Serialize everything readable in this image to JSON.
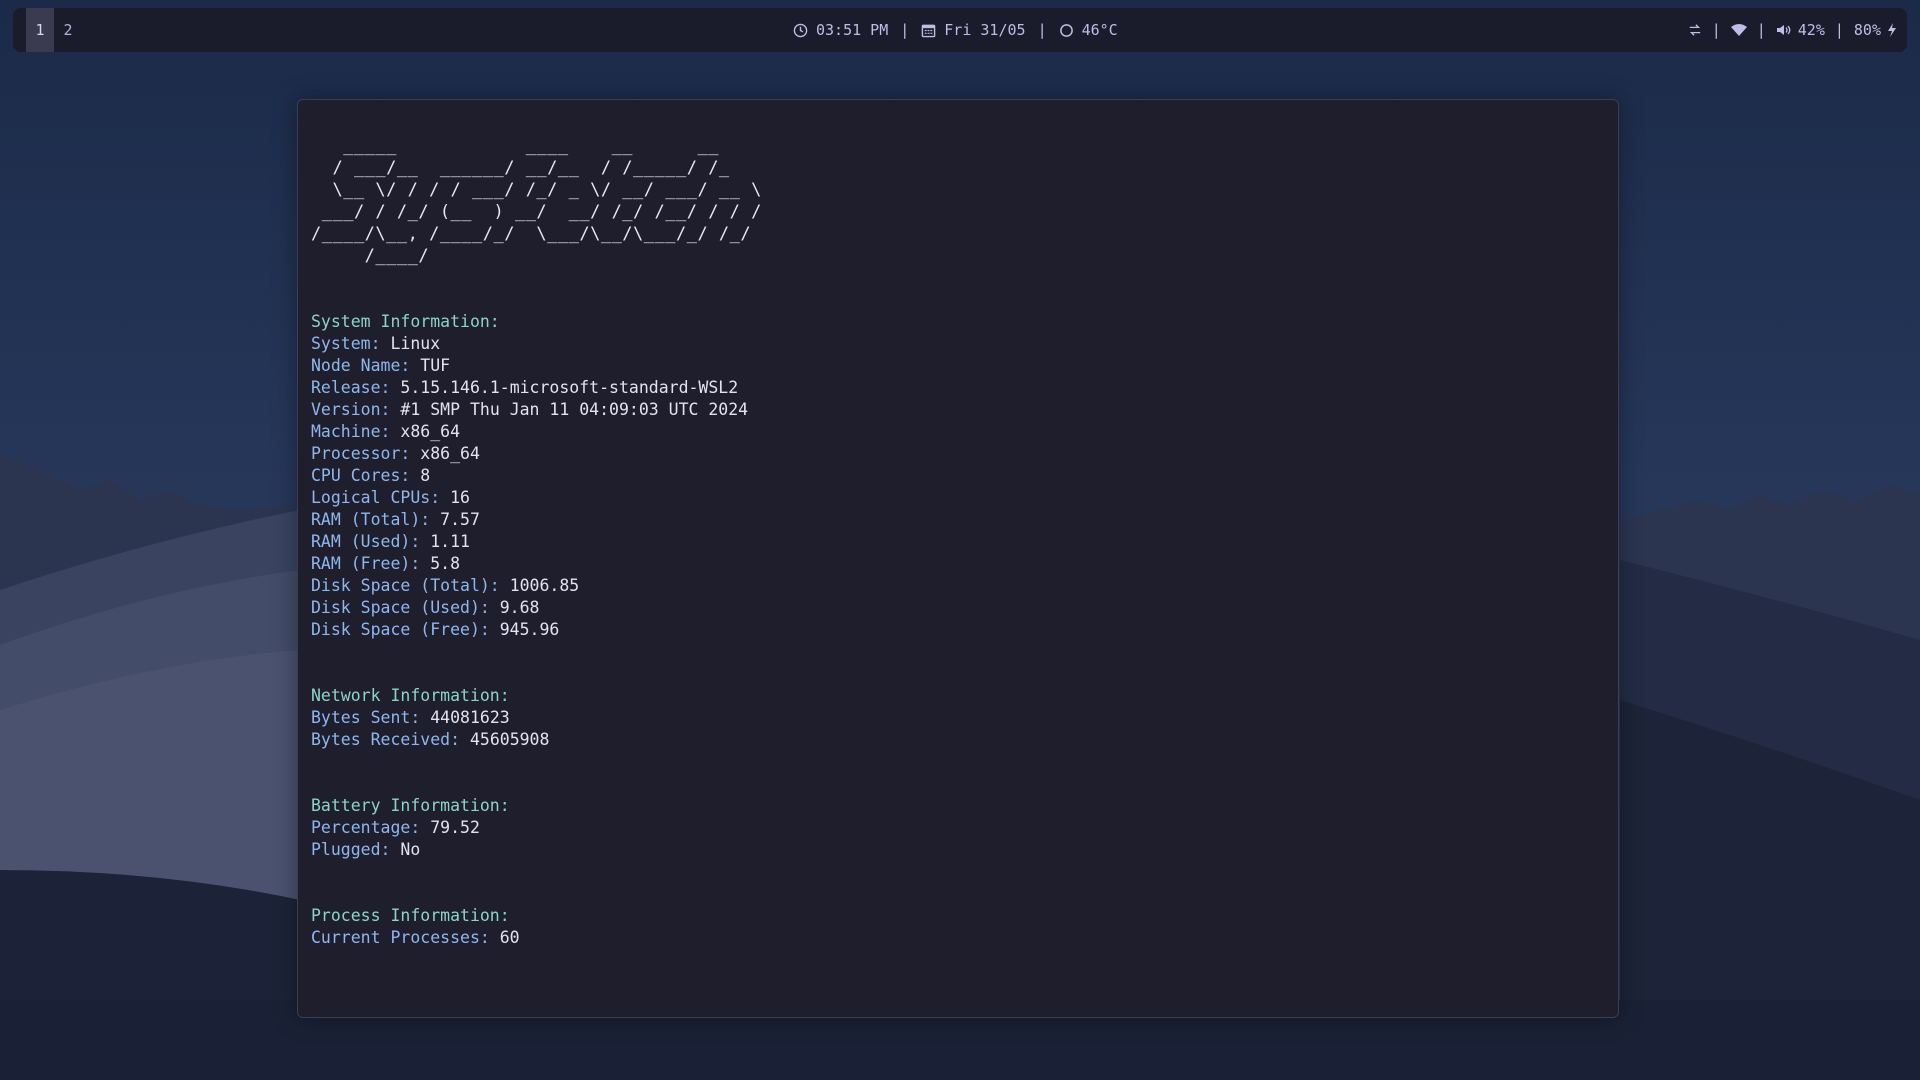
{
  "topbar": {
    "workspaces": [
      {
        "label": "1",
        "active": true
      },
      {
        "label": "2",
        "active": false
      }
    ],
    "clock": "03:51 PM",
    "date": "Fri 31/05",
    "temperature": "46°C",
    "separator": "|",
    "volume": "42%",
    "battery": "80%",
    "icons": [
      "clock-icon",
      "calendar-icon",
      "cpu-temp-icon",
      "network-transfer-icon",
      "wifi-icon",
      "volume-icon",
      "charging-icon"
    ]
  },
  "terminal": {
    "ascii_banner": "   _____            ____    __      __\n  / ___/__  ______/ __/__  / /_____/ /_\n  \\__ \\/ / / / ___/ /_/ _ \\/ __/ ___/ __ \\\n ___/ / /_/ (__  ) __/  __/ /_/ /__/ / / /\n/____/\\__, /____/_/  \\___/\\__/\\___/_/ /_/\n     /____/",
    "system": {
      "title": "System Information:",
      "rows": [
        {
          "key": "System:",
          "value": "Linux"
        },
        {
          "key": "Node Name:",
          "value": "TUF"
        },
        {
          "key": "Release:",
          "value": "5.15.146.1-microsoft-standard-WSL2"
        },
        {
          "key": "Version:",
          "value": "#1 SMP Thu Jan 11 04:09:03 UTC 2024"
        },
        {
          "key": "Machine:",
          "value": "x86_64"
        },
        {
          "key": "Processor:",
          "value": "x86_64"
        },
        {
          "key": "CPU Cores:",
          "value": "8"
        },
        {
          "key": "Logical CPUs:",
          "value": "16"
        },
        {
          "key": "RAM (Total):",
          "value": "7.57"
        },
        {
          "key": "RAM (Used):",
          "value": "1.11"
        },
        {
          "key": "RAM (Free):",
          "value": "5.8"
        },
        {
          "key": "Disk Space (Total):",
          "value": "1006.85"
        },
        {
          "key": "Disk Space (Used):",
          "value": "9.68"
        },
        {
          "key": "Disk Space (Free):",
          "value": "945.96"
        }
      ]
    },
    "network": {
      "title": "Network Information:",
      "rows": [
        {
          "key": "Bytes Sent:",
          "value": "44081623"
        },
        {
          "key": "Bytes Received:",
          "value": "45605908"
        }
      ]
    },
    "battery": {
      "title": "Battery Information:",
      "rows": [
        {
          "key": "Percentage:",
          "value": "79.52"
        },
        {
          "key": "Plugged:",
          "value": "No"
        }
      ]
    },
    "process": {
      "title": "Process Information:",
      "rows": [
        {
          "key": "Current Processes:",
          "value": "60"
        }
      ]
    }
  },
  "colors": {
    "topbar_bg": "#1a1b2b",
    "terminal_bg": "#1f1e2d",
    "section_title": "#8bd5c8",
    "key": "#8eb7ef",
    "value": "#e4e2f0",
    "status_text": "#c0bce6"
  }
}
